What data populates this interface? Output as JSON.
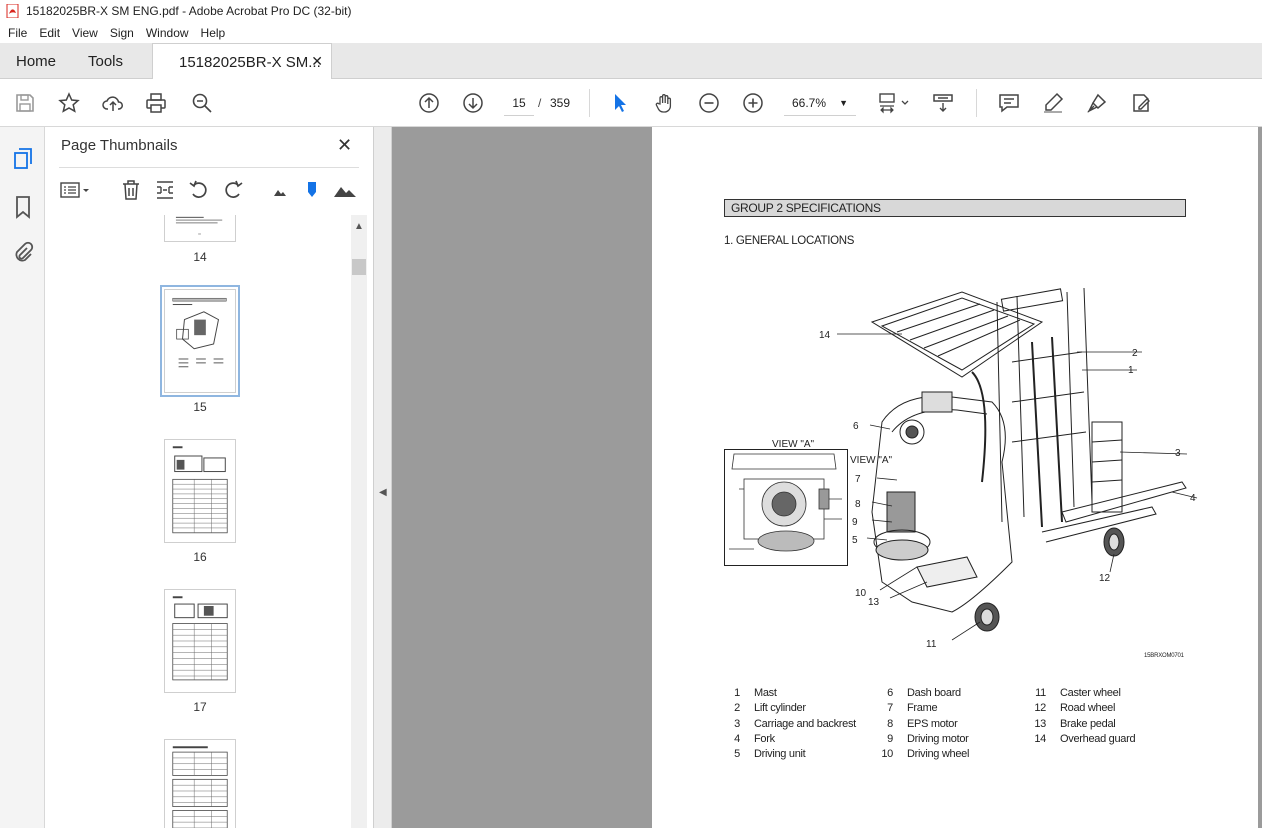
{
  "window": {
    "title": "15182025BR-X SM ENG.pdf - Adobe Acrobat Pro DC (32-bit)"
  },
  "menu": [
    "File",
    "Edit",
    "View",
    "Sign",
    "Window",
    "Help"
  ],
  "tabs": {
    "home": "Home",
    "tools": "Tools",
    "doc": "15182025BR-X SM..."
  },
  "toolbar": {
    "page_current": "15",
    "page_sep": "/",
    "page_total": "359",
    "zoom": "66.7%"
  },
  "thumbnails": {
    "title": "Page Thumbnails",
    "pages": [
      {
        "label": "14"
      },
      {
        "label": "15",
        "selected": true
      },
      {
        "label": "16"
      },
      {
        "label": "17"
      },
      {
        "label": ""
      }
    ]
  },
  "document": {
    "group_heading": "GROUP  2 SPECIFICATIONS",
    "section_heading": "1. GENERAL LOCATIONS",
    "view_label_inset": "VIEW \"A\"",
    "view_label_arrow": "VIEW \"A\"",
    "figure_code": "15BRXOM0701",
    "callouts": [
      "14",
      "2",
      "1",
      "6",
      "3",
      "7",
      "8",
      "4",
      "9",
      "5",
      "12",
      "10",
      "13",
      "11"
    ],
    "legend": [
      {
        "num": "1",
        "name": "Mast"
      },
      {
        "num": "2",
        "name": "Lift cylinder"
      },
      {
        "num": "3",
        "name": "Carriage and backrest"
      },
      {
        "num": "4",
        "name": "Fork"
      },
      {
        "num": "5",
        "name": "Driving unit"
      },
      {
        "num": "6",
        "name": "Dash board"
      },
      {
        "num": "7",
        "name": "Frame"
      },
      {
        "num": "8",
        "name": "EPS motor"
      },
      {
        "num": "9",
        "name": "Driving motor"
      },
      {
        "num": "10",
        "name": "Driving wheel"
      },
      {
        "num": "11",
        "name": "Caster wheel"
      },
      {
        "num": "12",
        "name": "Road wheel"
      },
      {
        "num": "13",
        "name": "Brake pedal"
      },
      {
        "num": "14",
        "name": "Overhead guard"
      }
    ]
  },
  "colors": {
    "accent": "#1473e6",
    "viewer_bg": "#9b9b9b",
    "pdf_red": "#d8251e"
  }
}
